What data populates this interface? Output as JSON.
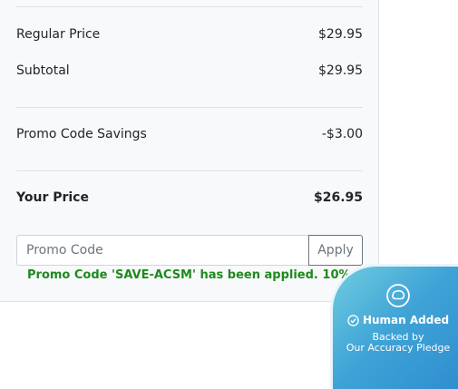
{
  "summary": {
    "regular_price_label": "Regular Price",
    "regular_price_value": "$29.95",
    "subtotal_label": "Subtotal",
    "subtotal_value": "$29.95",
    "savings_label": "Promo Code Savings",
    "savings_value": "-$3.00",
    "your_price_label": "Your Price",
    "your_price_value": "$26.95"
  },
  "promo": {
    "placeholder": "Promo Code",
    "apply_label": "Apply",
    "applied_message": "Promo Code 'SAVE-ACSM' has been applied. 10% off."
  },
  "badge": {
    "icon": "brain-icon",
    "title": "Human Added",
    "line1": "Backed by",
    "line2": "Our Accuracy Pledge"
  },
  "colors": {
    "success_text": "#1e8a1e",
    "badge_gradient_start": "#6fcde0",
    "badge_gradient_end": "#2d8bcf"
  }
}
